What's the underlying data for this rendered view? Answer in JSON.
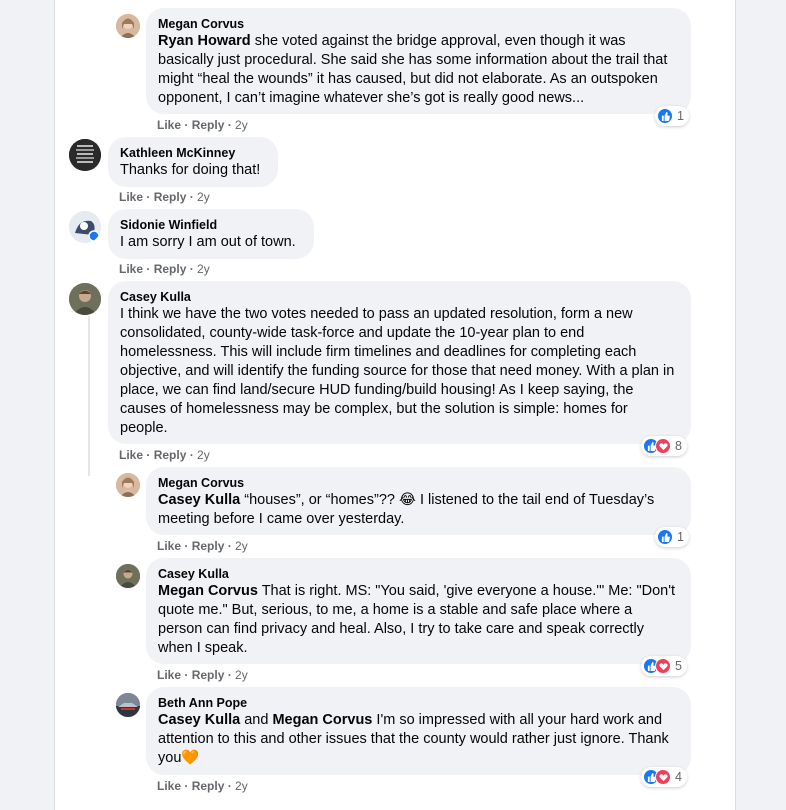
{
  "common": {
    "like": "Like",
    "reply": "Reply",
    "dot": " · "
  },
  "comments": [
    {
      "author": "Megan Corvus",
      "mention": "Ryan Howard",
      "text": " she voted against the bridge approval, even though it was basically just procedural. She said she has some information about the trail that might “heal the wounds” it has caused, but did not elaborate. As an outspoken opponent, I can’t imagine whatever she’s got is really good news...",
      "time": "2y",
      "reactions": "1"
    },
    {
      "author": "Kathleen McKinney",
      "text": "Thanks for doing that!",
      "time": "2y"
    },
    {
      "author": "Sidonie Winfield",
      "text": "I am sorry I am out of town.",
      "time": "2y"
    },
    {
      "author": "Casey Kulla",
      "text": "I think we have the two votes needed to pass an updated resolution, form a new consolidated, county-wide task-force and update the 10-year plan to end homelessness. This will include firm timelines and deadlines for completing each objective, and will identify the funding source for those that need money. With a plan in place, we can find land/secure HUD funding/build housing! As I keep saying, the causes of homelessness may be complex, but the solution is simple: homes for people.",
      "time": "2y",
      "reactions": "8"
    },
    {
      "author": "Megan Corvus",
      "mention": "Casey Kulla",
      "text_a": " “houses”, or “homes”?? ",
      "emoji": "😂",
      "text_b": " I listened to the tail end of Tuesday’s meeting before I came over yesterday.",
      "time": "2y",
      "reactions": "1"
    },
    {
      "author": "Casey Kulla",
      "mention": "Megan Corvus",
      "text": " That is right. MS: \"You said, 'give everyone a house.'\" Me: \"Don't quote me.\" But, serious, to me, a home is a stable and safe place where a person can find privacy and heal. Also, I try to take care and speak correctly when I speak.",
      "time": "2y",
      "reactions": "5"
    },
    {
      "author": "Beth Ann Pope",
      "mention": "Casey Kulla",
      "joiner": " and ",
      "mention2": "Megan Corvus",
      "text": " I'm so impressed with all your hard work and attention to this and other issues that the county would rather just ignore. Thank you",
      "emoji": "🧡",
      "time": "2y",
      "reactions": "4"
    }
  ],
  "colors": {
    "like": "#1877f2",
    "love": "#f33e58",
    "bubble": "#f0f2f5",
    "meta": "#65676b"
  }
}
